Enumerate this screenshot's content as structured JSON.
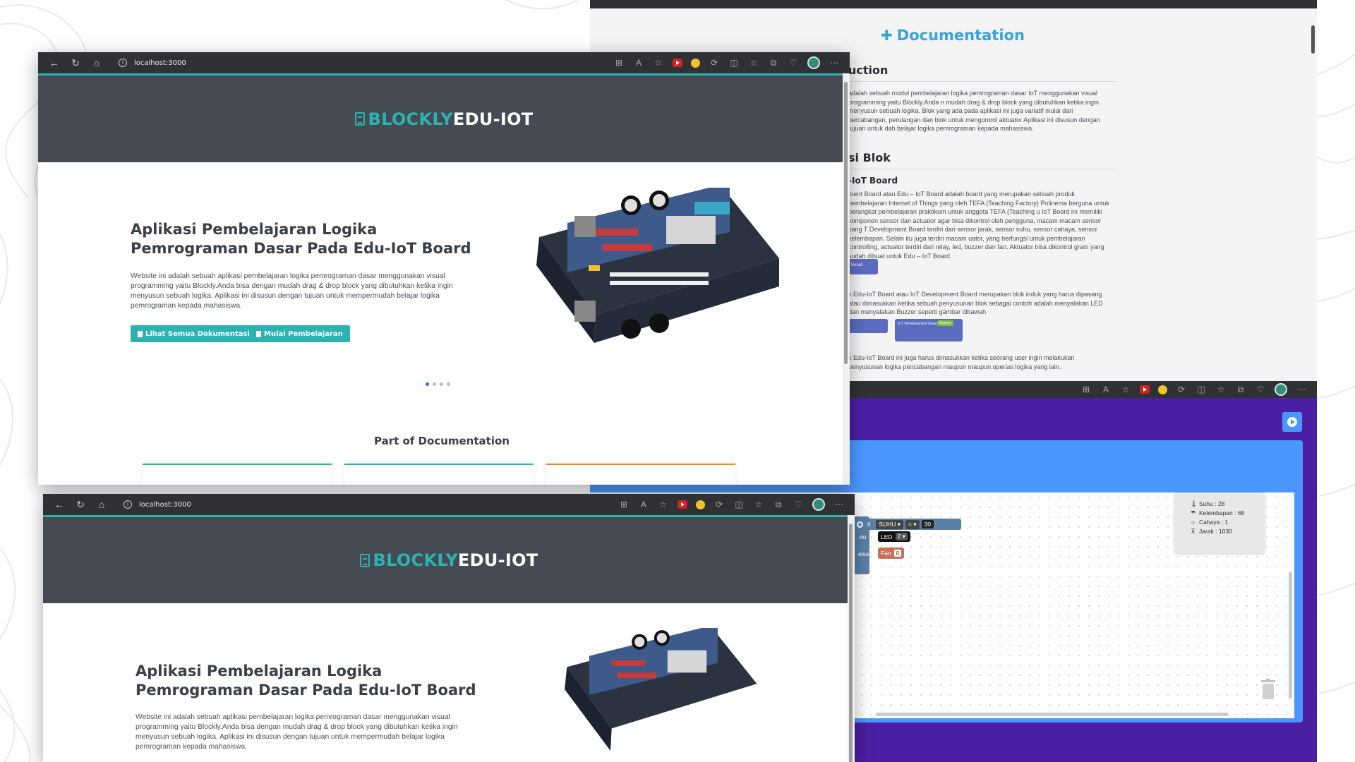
{
  "browser": {
    "url": "localhost:3000"
  },
  "app": {
    "brand_part1": "BLOCKLY",
    "brand_part2": "EDU-IOT",
    "hero_title": "Aplikasi Pembelajaran Logika Pemrograman Dasar Pada Edu-IoT Board",
    "hero_desc": "Website ini adalah sebuah aplikasi pembelajaran logika pemrograman dasar menggunakan visual programming yaitu Blockly.Anda bisa dengan mudah drag & drop block yang dibutuhkan ketika ingin menyusun sebuah logika. Aplikasi ini disusun dengan tujuan untuk mempermudah belajar logika pemrograman kepada mahasiswa.",
    "btn_docs": "Lihat Semua Dokumentasi",
    "btn_learn": "Mulai Pembelajaran",
    "section_title": "Part of Documentation"
  },
  "documentation": {
    "title": "Documentation",
    "intro_heading": "uction",
    "intro_text": "adalah sebuah modul pembelajaran logika pemrograman dasar IoT menggunakan visual programming yaitu Blockly.Anda n mudah drag & drop block yang dibutuhkan ketika ingin menyusun sebuah logika. Blok yang ada pada aplikasi ini juga variatif mulai dari percabangan, perulangan dan blok untuk mengontrol aktuator Aplikasi ini disusun dengan tujuan untuk dah belajar logika pemrograman kepada mahasiswa.",
    "blok_heading": "si Blok",
    "board_heading": "-IoT Board",
    "board_text": "ment Board atau Edu – IoT Board adalah board yang merupakan sebuah produk pembelajaran Internet of Things yang oleh TEFA (Teaching Factory) Polinema berguna untuk perangkat pembelajaran praktikum untuk anggota TEFA (Teaching u IoT Board ini memiliki komponen sensor dan actuator agar bisa dikontrol oleh pengguna, macam macam sensor yang T Development Board terdiri dari sensor jarak, sensor suhu, sensor cahaya, sensor kelembapan. Selain itu juga terdiri macam uator, yang berfungsi untuk pembelajaran controlling, actuator terdiri dari relay, led, buzzer dan fan. Aktuator bisa dikontrol gram yang sudah dibuat untuk Edu – IoT Board.",
    "block_label1": "Board",
    "block_text2": "k Edu-IoT Board atau IoT Development Board merupakan blok induk yang harus dipasang atau dimasukkan ketika sebuah penyusunan blok sebagai contoh adalah menyalakan LED dan menyalakan Buzzer seperti gambar dibawah",
    "block_label2": "IoT Development Board",
    "block_label3": "Buzzer",
    "block_text3": "k Edu-IoT Board ini juga harus dimasukkan ketika seorang user ingin melakukan penyusunan logika pencabangan maupun maupun operasi logika yang lain."
  },
  "blockly": {
    "if_label": "if",
    "do_label": "do",
    "else_label": "else",
    "sensor_field": "SUHU",
    "operator": "<",
    "value": "30",
    "led_label": "LED",
    "led_value": "2",
    "fan_label": "Fan",
    "fan_value": "0",
    "sensors": [
      {
        "label": "Suhu : 28",
        "icon": "thermometer-icon"
      },
      {
        "label": "Kelembapan : 68",
        "icon": "humidity-icon"
      },
      {
        "label": "Cahaya : 1",
        "icon": "sun-icon"
      },
      {
        "label": "Jarak : 1030",
        "icon": "distance-icon"
      }
    ]
  },
  "colors": {
    "accent": "#2bb3b1",
    "header_dark": "#464b53",
    "blockly_purple": "#4b1fa3",
    "blockly_blue": "#4c97ff",
    "doc_title": "#3aa3d9"
  }
}
